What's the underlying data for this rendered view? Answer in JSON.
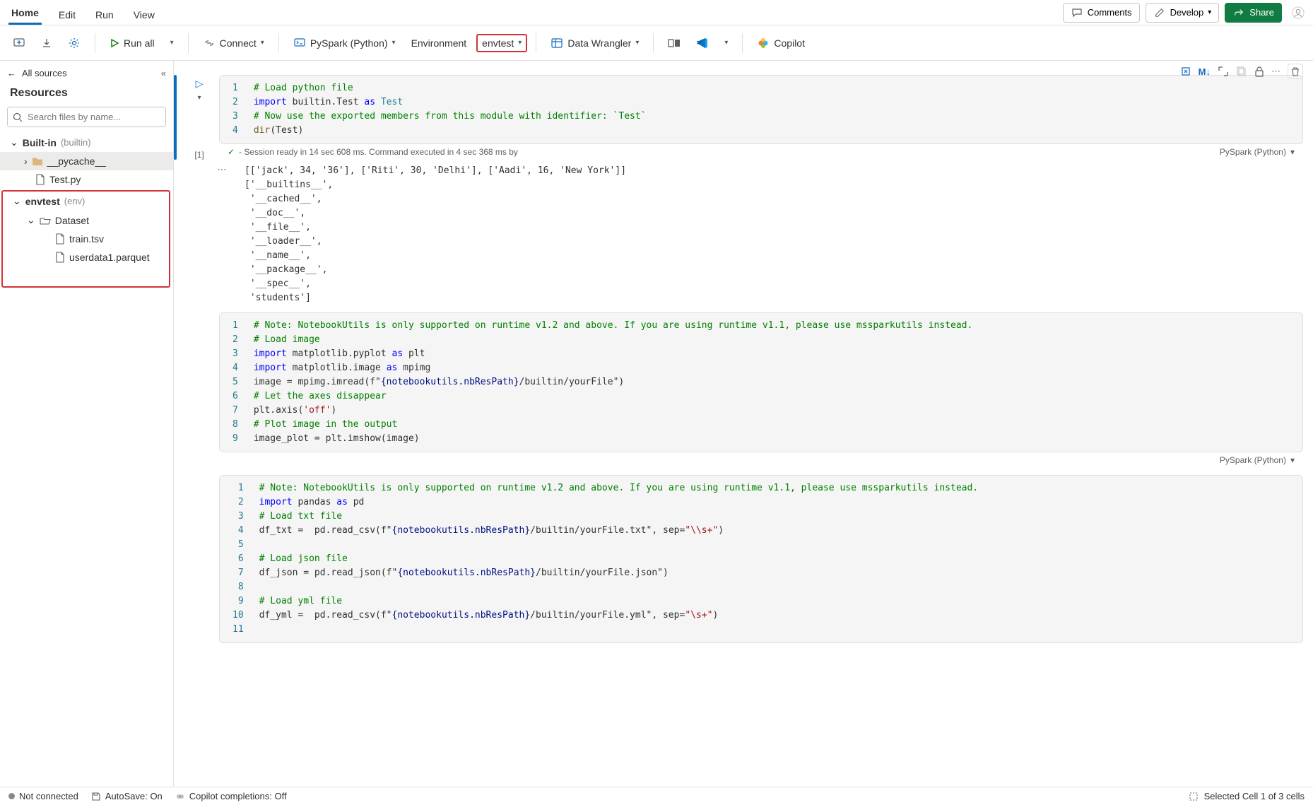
{
  "tabs": {
    "home": "Home",
    "edit": "Edit",
    "run": "Run",
    "view": "View"
  },
  "topright": {
    "comments": "Comments",
    "develop": "Develop",
    "share": "Share"
  },
  "toolbar": {
    "run_all": "Run all",
    "connect": "Connect",
    "pyspark": "PySpark (Python)",
    "environment": "Environment",
    "envtest": "envtest",
    "data_wrangler": "Data Wrangler",
    "copilot": "Copilot"
  },
  "sidebar": {
    "all_sources": "All sources",
    "resources": "Resources",
    "search_placeholder": "Search files by name...",
    "builtin_label": "Built-in",
    "builtin_note": "(builtin)",
    "pycache": "__pycache__",
    "testpy": "Test.py",
    "envtest_label": "envtest",
    "envtest_note": "(env)",
    "dataset": "Dataset",
    "train": "train.tsv",
    "userdata": "userdata1.parquet"
  },
  "cell1": {
    "exec": "[1]",
    "l1": "# Load python file",
    "l2a": "import",
    "l2b": " builtin.Test ",
    "l2c": "as",
    "l2d": " Test",
    "l3": "# Now use the exported members from this module with identifier: `Test`",
    "l4a": "dir",
    "l4b": "(Test)",
    "status": "- Session ready in 14 sec 608 ms. Command executed in 4 sec 368 ms by",
    "lang": "PySpark (Python)",
    "output": "[['jack', 34, '36'], ['Riti', 30, 'Delhi'], ['Aadi', 16, 'New York']]\n['__builtins__',\n '__cached__',\n '__doc__',\n '__file__',\n '__loader__',\n '__name__',\n '__package__',\n '__spec__',\n 'students']"
  },
  "cell2": {
    "l1": "# Note: NotebookUtils is only supported on runtime v1.2 and above. If you are using runtime v1.1, please use mssparkutils instead.",
    "l2": "# Load image",
    "l3a": "import",
    "l3b": " matplotlib.pyplot ",
    "l3c": "as",
    "l3d": " plt",
    "l4a": "import",
    "l4b": " matplotlib.image ",
    "l4c": "as",
    "l4d": " mpimg",
    "l5a": "image = mpimg.imread(f\"",
    "l5b": "{notebookutils.nbResPath}",
    "l5c": "/builtin/yourFile\")",
    "l6": "# Let the axes disappear",
    "l7a": "plt.axis(",
    "l7b": "'off'",
    "l7c": ")",
    "l8": "# Plot image in the output",
    "l9": "image_plot = plt.imshow(image)",
    "lang": "PySpark (Python)"
  },
  "cell3": {
    "l1": "# Note: NotebookUtils is only supported on runtime v1.2 and above. If you are using runtime v1.1, please use mssparkutils instead.",
    "l2a": "import",
    "l2b": " pandas ",
    "l2c": "as",
    "l2d": " pd",
    "l3": "# Load txt file",
    "l4a": "df_txt =  pd.read_csv(f\"",
    "l4b": "{notebookutils.nbResPath}",
    "l4c": "/builtin/yourFile.txt\", sep=",
    "l4d": "\"\\\\s+\"",
    "l4e": ")",
    "l6": "# Load json file",
    "l7a": "df_json = pd.read_json(f\"",
    "l7b": "{notebookutils.nbResPath}",
    "l7c": "/builtin/yourFile.json\")",
    "l9": "# Load yml file",
    "l10a": "df_yml =  pd.read_csv(f\"",
    "l10b": "{notebookutils.nbResPath}",
    "l10c": "/builtin/yourFile.yml\", sep=",
    "l10d": "\"\\s+\"",
    "l10e": ")"
  },
  "statusbar": {
    "not_connected": "Not connected",
    "autosave": "AutoSave: On",
    "copilot": "Copilot completions: Off",
    "selection": "Selected Cell 1 of 3 cells"
  }
}
